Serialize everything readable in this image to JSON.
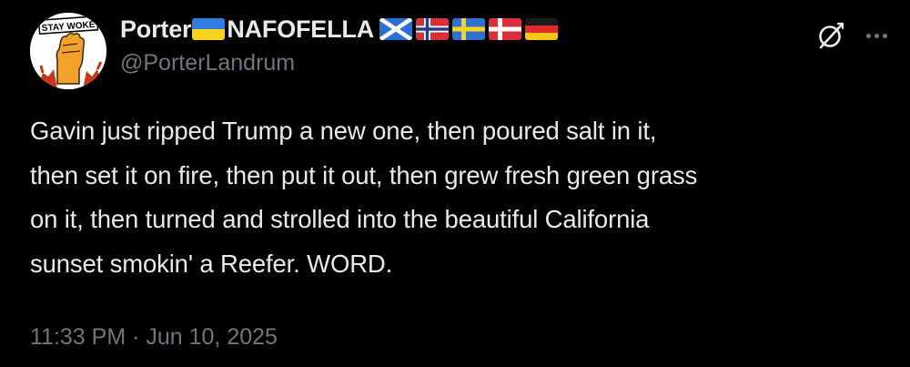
{
  "author": {
    "name": "Porter",
    "name_suffix": "NAFOFELLA",
    "handle": "@PorterLandrum",
    "avatar_text": "STAY WOKE",
    "flags": [
      "ukraine-flag",
      "scotland-flag",
      "norway-flag",
      "sweden-flag",
      "denmark-flag",
      "germany-flag"
    ]
  },
  "tweet": {
    "text": "Gavin just ripped Trump a new one, then poured salt in it,\nthen set it on fire, then put it out, then grew fresh green grass\non it, then turned and strolled into the beautiful California\nsunset smokin' a Reefer. WORD.",
    "timestamp": "11:33 PM · Jun 10, 2025"
  },
  "icons": {
    "grok": "grok-icon",
    "more": "more-options-icon"
  },
  "colors": {
    "background": "#000000",
    "text_primary": "#e7e9ea",
    "text_secondary": "#71767b"
  }
}
